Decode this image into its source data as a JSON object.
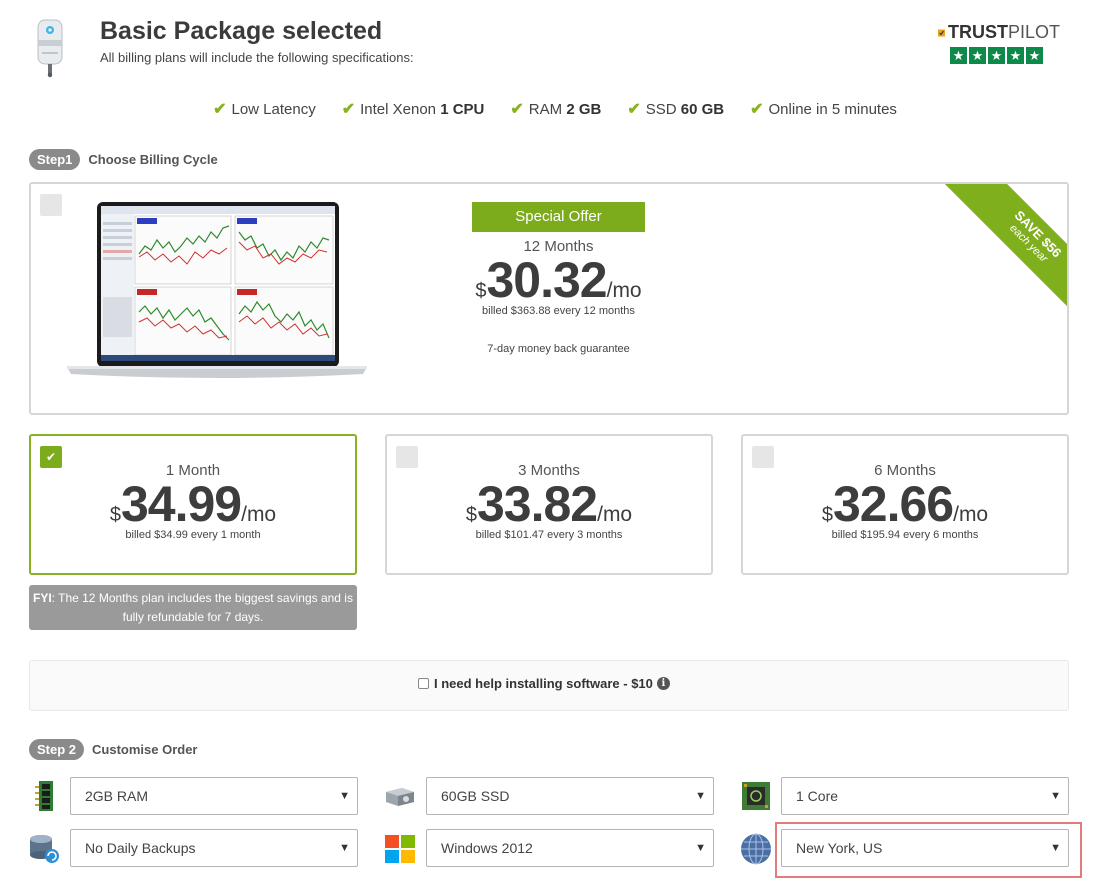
{
  "header": {
    "title": "Basic Package selected",
    "subtitle": "All billing plans will include the following specifications:",
    "trustpilot_left": "TRUST",
    "trustpilot_right": "PILOT",
    "trustpilot_stars": [
      "★",
      "★",
      "★",
      "★",
      "★"
    ]
  },
  "features": [
    {
      "text": "Low Latency",
      "bold": ""
    },
    {
      "text": "Intel Xenon ",
      "bold": "1 CPU"
    },
    {
      "text": "RAM ",
      "bold": "2 GB"
    },
    {
      "text": "SSD ",
      "bold": "60 GB"
    },
    {
      "text": "Online in 5 minutes",
      "bold": ""
    }
  ],
  "step1": {
    "pill": "Step1",
    "label": "Choose Billing Cycle"
  },
  "offer": {
    "badge": "Special Offer",
    "months": "12 Months",
    "currency": "$",
    "amount": "30.32",
    "per": "/mo",
    "billed": "billed $363.88 every 12 months",
    "guarantee": "7-day money back guarantee",
    "ribbon_big": "SAVE $56",
    "ribbon_small": "each year"
  },
  "plans": [
    {
      "months": "1 Month",
      "currency": "$",
      "amount": "34.99",
      "per": "/mo",
      "billed": "billed $34.99 every 1 month",
      "selected": true
    },
    {
      "months": "3 Months",
      "currency": "$",
      "amount": "33.82",
      "per": "/mo",
      "billed": "billed $101.47 every 3 months",
      "selected": false
    },
    {
      "months": "6 Months",
      "currency": "$",
      "amount": "32.66",
      "per": "/mo",
      "billed": "billed $195.94 every 6 months",
      "selected": false
    }
  ],
  "fyi": {
    "bold": "FYI",
    "text": ": The 12 Months plan includes the biggest savings and is fully refundable for 7 days."
  },
  "help": {
    "label": "I need help installing software - $10",
    "info": "i"
  },
  "step2": {
    "pill": "Step 2",
    "label": "Customise Order"
  },
  "options": {
    "ram": "2GB RAM",
    "ssd": "60GB SSD",
    "cores": "1 Core",
    "backups": "No Daily Backups",
    "os": "Windows 2012",
    "location": "New York, US",
    "arrow": "▼"
  },
  "colors": {
    "accent": "#7cab1c",
    "trustpilot": "#0d8a4a",
    "highlight": "#e07c7c"
  }
}
